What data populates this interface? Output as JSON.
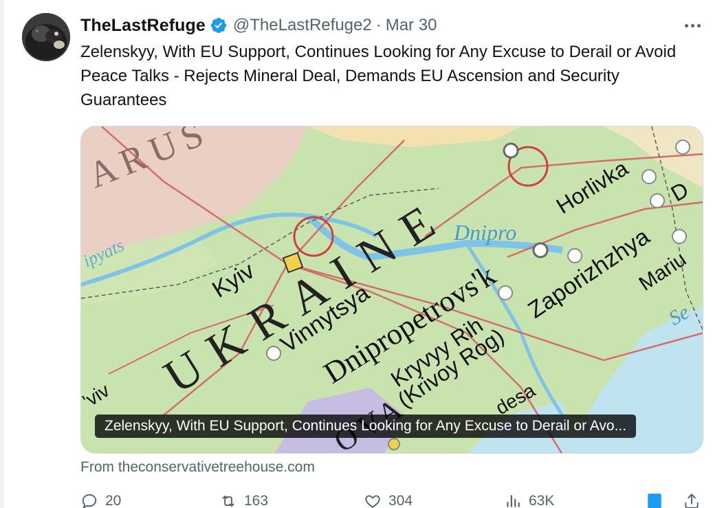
{
  "tweet": {
    "display_name": "TheLastRefuge",
    "handle": "@TheLastRefuge2",
    "separator": "·",
    "date": "Mar 30",
    "verified": true,
    "text": "Zelenskyy, With EU Support, Continues Looking for Any Excuse to Derail or Avoid Peace Talks - Rejects Mineral Deal, Demands EU Ascension and Security Guarantees"
  },
  "card": {
    "caption": "Zelenskyy, With EU Support, Continues Looking for Any Excuse to Derail or Avo...",
    "source_prefix": "From ",
    "source_domain": "theconservativetreehouse.com",
    "map_labels": {
      "country": "UKRAINE",
      "belarus": "ARUS",
      "kyiv": "Kyiv",
      "vinnytsya": "Vinnytsya",
      "dnipropetrovsk": "Dnipropetrovs'k",
      "dnipro": "Dnipro",
      "horlivka": "Horlivka",
      "zaporizhzhya": "Zaporizhzhya",
      "kryvyy_rih": "Kryvyy Rih",
      "krivoy_rog": "(Krivoy Rog)",
      "dnipropetrovsk_partial": "Dnipro",
      "lviv_partial": "'viv",
      "moldova_partial": "OVA",
      "odesa_partial": "desa",
      "mariupol_partial": "Mariu",
      "sea_partial": "Se",
      "donetsk_partial": "D",
      "pripyats_partial": "ipyats"
    }
  },
  "actions": {
    "replies": "20",
    "reposts": "163",
    "likes": "304",
    "views": "63K"
  },
  "colors": {
    "verified_blue": "#1d9bf0",
    "text_secondary": "#536471",
    "bookmark_blue": "#1d9bf0"
  }
}
